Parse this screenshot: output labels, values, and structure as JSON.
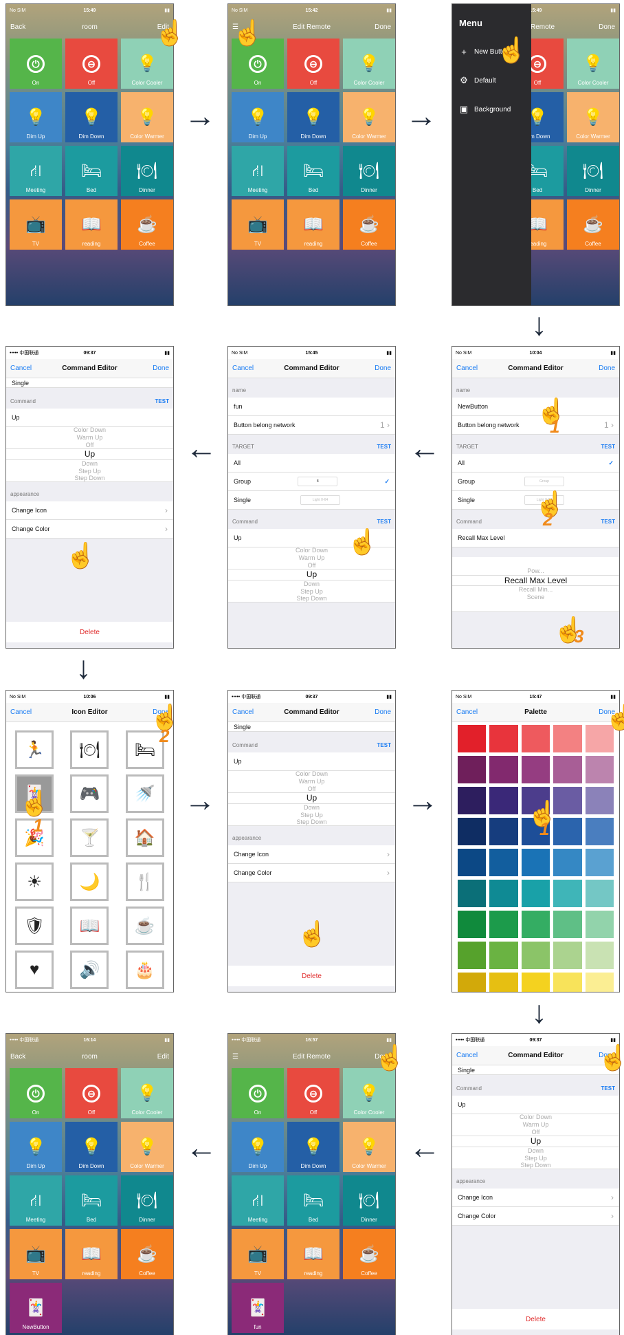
{
  "remote": {
    "title": "room",
    "back": "Back",
    "edit": "Edit",
    "status_nosim": "No SIM ",
    "status_carrier": "••••• 中国联通 ",
    "time1": "15:49",
    "time10": "16:14",
    "tiles": [
      {
        "label": "On",
        "color": "#55b54a",
        "icon": "power-icon",
        "glyph": "⏻"
      },
      {
        "label": "Off",
        "color": "#e84a3f",
        "icon": "power-off-icon",
        "glyph": "⊖"
      },
      {
        "label": "Color Cooler",
        "color": "#8fd1b6",
        "icon": "bulb-icon",
        "glyph": "💡"
      },
      {
        "label": "Dim Up",
        "color": "#3e86c8",
        "icon": "bulb-up-icon",
        "glyph": "💡"
      },
      {
        "label": "Dim Down",
        "color": "#245fa6",
        "icon": "bulb-down-icon",
        "glyph": "💡"
      },
      {
        "label": "Color Warmer",
        "color": "#f7b26d",
        "icon": "bulb-warm-icon",
        "glyph": "💡"
      },
      {
        "label": "Meeting",
        "color": "#2fa6a7",
        "icon": "meeting-icon",
        "glyph": "⛙"
      },
      {
        "label": "Bed",
        "color": "#1c9b9f",
        "icon": "bed-icon",
        "glyph": "🛏"
      },
      {
        "label": "Dinner",
        "color": "#10888e",
        "icon": "dinner-icon",
        "glyph": "🍽"
      },
      {
        "label": "TV",
        "color": "#f5983e",
        "icon": "tv-icon",
        "glyph": "📺"
      },
      {
        "label": "reading",
        "color": "#f5983e",
        "icon": "book-icon",
        "glyph": "📖"
      },
      {
        "label": "Coffee",
        "color": "#f57f1f",
        "icon": "coffee-icon",
        "glyph": "☕"
      }
    ],
    "new_tile_10": "NewButton",
    "new_tile_11": "fun"
  },
  "edit_remote": {
    "title": "Edit Remote",
    "done": "Done",
    "time2": "15:42",
    "time11": "16:57"
  },
  "menu": {
    "title": "Menu",
    "items": [
      "New Button",
      "Default",
      "Background"
    ],
    "time3": "15:49"
  },
  "cmd": {
    "title": "Command Editor",
    "cancel": "Cancel",
    "done": "Done",
    "test": "TEST",
    "name_section": "name",
    "name_new": "NewButton",
    "name_fun": "fun",
    "belong": "Button belong network",
    "belong_val": "1",
    "target": "TARGET",
    "all": "All",
    "group": "Group",
    "single": "Single",
    "group_ph": "Group",
    "group_val": "8",
    "single_ph": "Light 0-64",
    "command": "Command",
    "recall": "Recall Max Level",
    "up": "Up",
    "picker_rc": [
      "Pow...",
      "Recall Max Level",
      "Recall Min...",
      "Scene"
    ],
    "picker_up": [
      "Color Down",
      "Warm Up",
      "Off",
      "Up",
      "Down",
      "Step Up",
      "Step Down"
    ],
    "appearance": "appearance",
    "change_icon": "Change Icon",
    "change_color": "Change Color",
    "delete": "Delete",
    "time4": "09:37",
    "time5": "15:45",
    "time6": "10:04",
    "time8": "09:37",
    "time12": "09:37"
  },
  "icon_editor": {
    "title": "Icon Editor",
    "cancel": "Cancel",
    "done": "Done",
    "time": "10:06",
    "icons": [
      "🏃",
      "🍽",
      "🛏",
      "🃏",
      "🎮",
      "🚿",
      "🎉",
      "🍸",
      "🏠",
      "☀",
      "🌙",
      "🍴",
      "🛡",
      "📖",
      "☕",
      "♥",
      "🔊",
      "🎂"
    ]
  },
  "palette": {
    "title": "Palette",
    "cancel": "Cancel",
    "done": "Done",
    "time": "15:47",
    "colors": [
      "#e2202a",
      "#e8343c",
      "#ee5a5e",
      "#f38182",
      "#f6a6a7",
      "#6f1f5b",
      "#82296e",
      "#953d81",
      "#a85e96",
      "#bc84ae",
      "#2d1e5e",
      "#3a2878",
      "#4c3d8c",
      "#6a5ca3",
      "#8b82b9",
      "#0f2d63",
      "#163d7e",
      "#1d4e98",
      "#2b64ad",
      "#4a7ebf",
      "#0c4885",
      "#125e9e",
      "#1a73b6",
      "#3588c4",
      "#5aa1d1",
      "#0b6f78",
      "#0f8a94",
      "#19a1a8",
      "#3fb5b8",
      "#74c7c5",
      "#108a3c",
      "#1c9b4b",
      "#34ad63",
      "#5fbf86",
      "#92d3ab",
      "#56a22c",
      "#6ab342",
      "#8bc468",
      "#abd38f",
      "#c9e2b3",
      "#d2a90a",
      "#e6bf12",
      "#f4d21f",
      "#f8e35a",
      "#fbee93"
    ]
  },
  "hints": [
    "1",
    "2",
    "3"
  ]
}
